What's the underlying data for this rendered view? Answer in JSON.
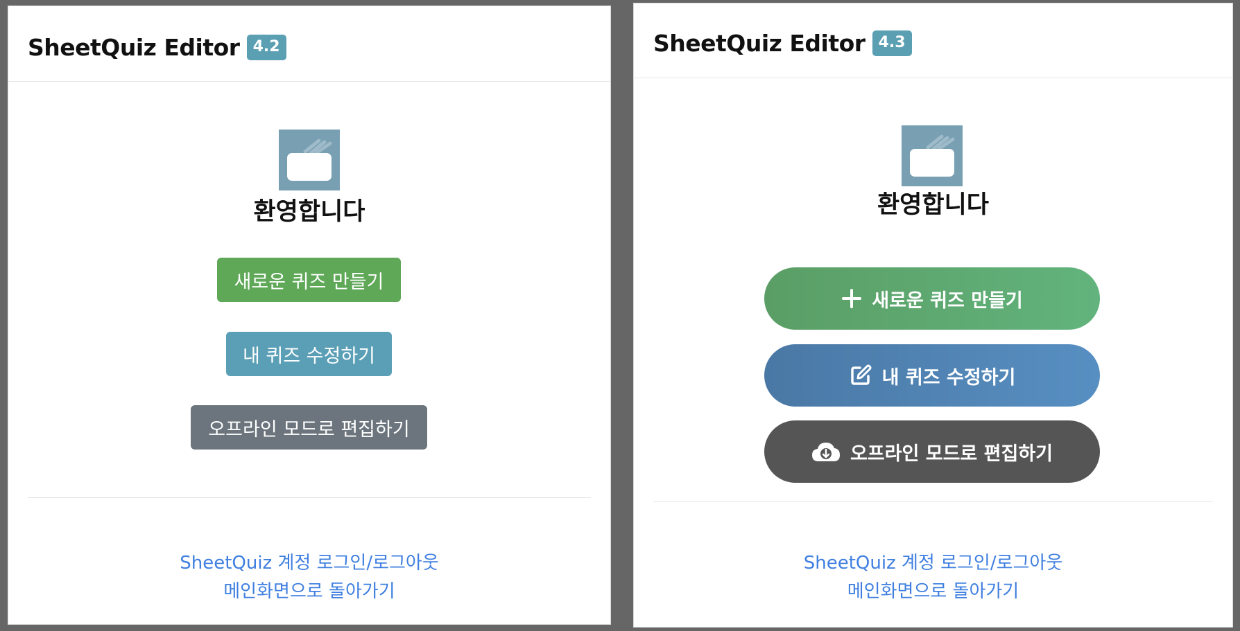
{
  "colors": {
    "background": "#666666",
    "panel": "#ffffff",
    "version_badge": "#5b9fb3",
    "link": "#3f7fe0",
    "new_button_left": "#5fa858",
    "edit_button_left": "#5b9fb6",
    "offline_button_left": "#6c757d",
    "new_button_right": "#5ea96f",
    "edit_button_right": "#5084b5",
    "offline_button_right": "#555555"
  },
  "left_panel": {
    "app_title": "SheetQuiz Editor",
    "version": "4.2",
    "logo_icon": "sheetquiz-logo-icon",
    "welcome": "환영합니다",
    "buttons": {
      "new_quiz": "새로운 퀴즈 만들기",
      "edit_quiz": "내 퀴즈 수정하기",
      "offline_edit": "오프라인 모드로 편집하기"
    },
    "links": {
      "account": "SheetQuiz 계정 로그인/로그아웃",
      "home": "메인화면으로 돌아가기"
    }
  },
  "right_panel": {
    "app_title": "SheetQuiz Editor",
    "version": "4.3",
    "logo_icon": "sheetquiz-logo-icon",
    "welcome": "환영합니다",
    "buttons": {
      "new_quiz": "새로운 퀴즈 만들기",
      "new_quiz_icon": "plus-icon",
      "edit_quiz": "내 퀴즈 수정하기",
      "edit_quiz_icon": "edit-icon",
      "offline_edit": "오프라인 모드로 편집하기",
      "offline_edit_icon": "cloud-download-icon"
    },
    "links": {
      "account": "SheetQuiz 계정 로그인/로그아웃",
      "home": "메인화면으로 돌아가기"
    }
  }
}
